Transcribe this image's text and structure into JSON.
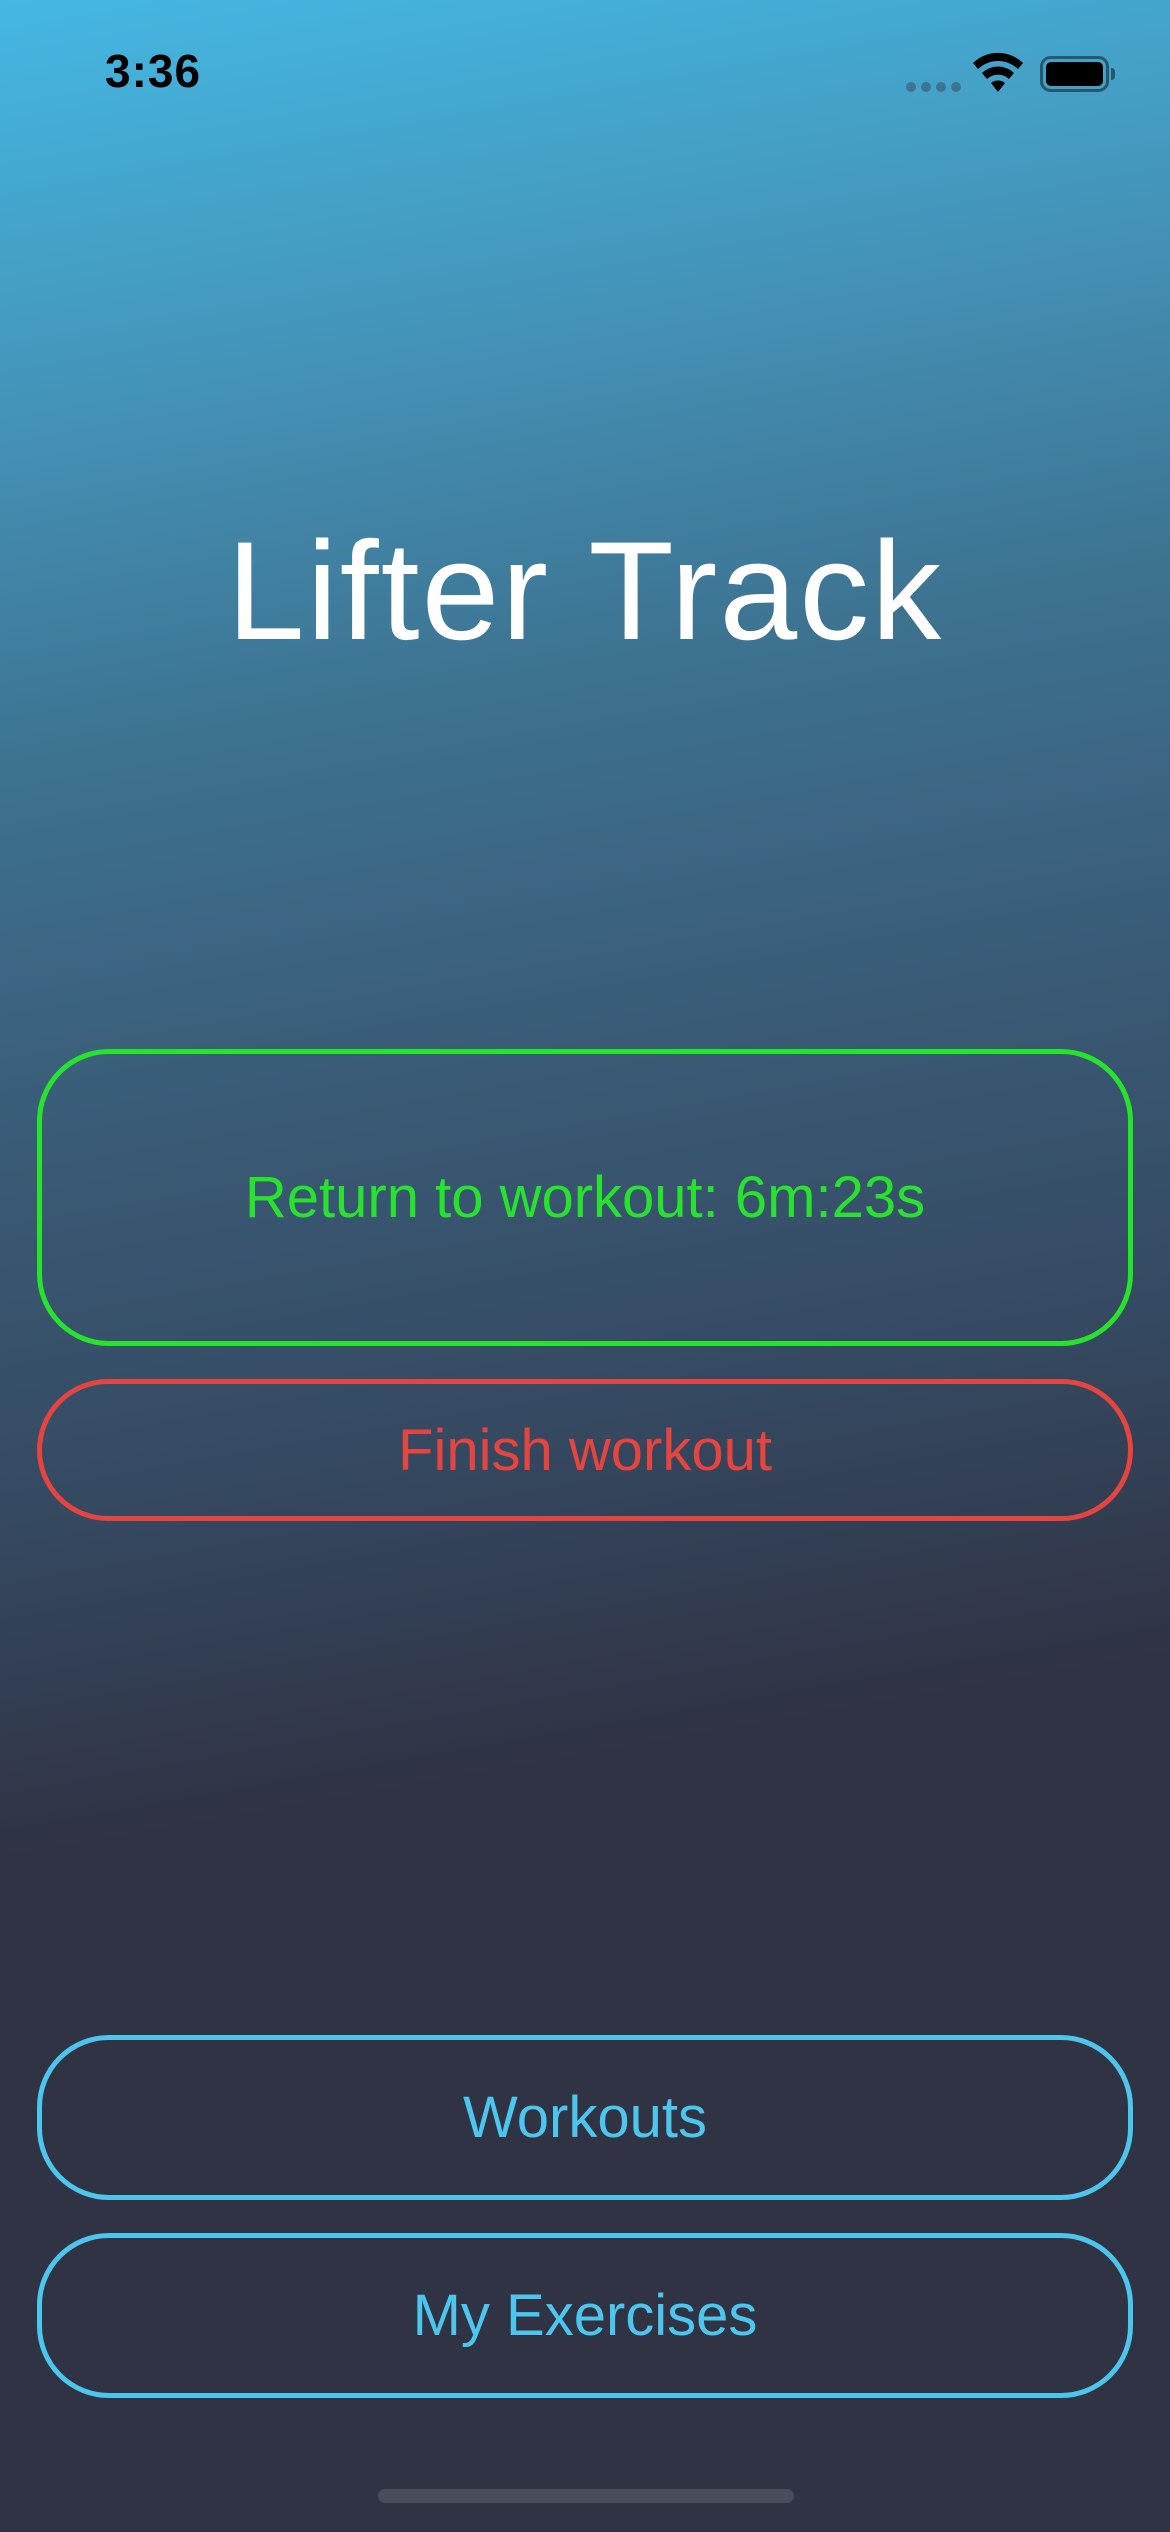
{
  "status_bar": {
    "time": "3:36",
    "text_color": "#000000"
  },
  "app": {
    "title": "Lifter Track"
  },
  "buttons": {
    "return_workout": {
      "label": "Return to workout: 6m:23s",
      "color": "#27e32e"
    },
    "finish_workout": {
      "label": "Finish workout",
      "color": "#e6443f"
    },
    "workouts": {
      "label": "Workouts",
      "color": "#4cc6ec"
    },
    "my_exercises": {
      "label": "My Exercises",
      "color": "#4cc6ec"
    }
  },
  "icons": {
    "cellular": "cellular-signal-icon",
    "wifi": "wifi-icon",
    "battery": "battery-icon"
  },
  "theme": {
    "background_top": "#44b8e2",
    "background_bottom": "#2f3343",
    "title_color": "#ffffff"
  }
}
